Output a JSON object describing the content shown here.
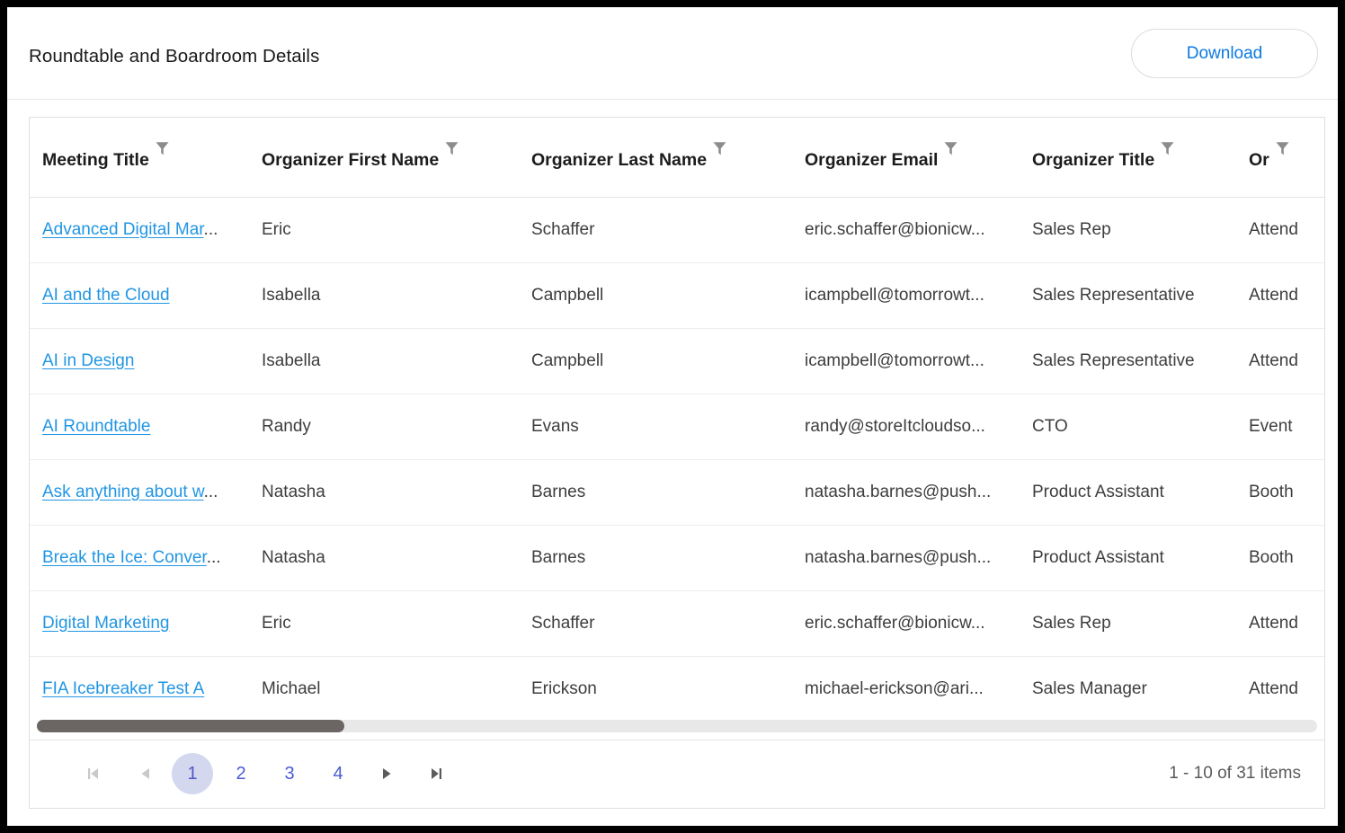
{
  "panel": {
    "title": "Roundtable and Boardroom Details",
    "download_label": "Download",
    "accent_link_color": "#2196e3",
    "download_text_color": "#0a7ae0",
    "pager_active_bg": "#d3d8ef",
    "pager_text_color": "#4a5bd4",
    "scrollbar_thumb_color": "#6b6564"
  },
  "grid": {
    "columns": [
      {
        "key": "meeting_title",
        "label": "Meeting Title",
        "filter_icon": "filter-funnel-icon"
      },
      {
        "key": "organizer_first",
        "label": "Organizer First Name",
        "filter_icon": "filter-funnel-icon"
      },
      {
        "key": "organizer_last",
        "label": "Organizer Last Name",
        "filter_icon": "filter-funnel-icon"
      },
      {
        "key": "organizer_email",
        "label": "Organizer Email",
        "filter_icon": "filter-funnel-icon"
      },
      {
        "key": "organizer_title",
        "label": "Organizer Title",
        "filter_icon": "filter-funnel-icon"
      },
      {
        "key": "organizer_role",
        "label": "Or",
        "filter_icon": "filter-funnel-icon"
      }
    ],
    "rows": [
      {
        "meeting_title": "Advanced Digital Mar",
        "meeting_title_truncated": true,
        "organizer_first": "Eric",
        "organizer_last": "Schaffer",
        "organizer_email": "eric.schaffer@bionicw...",
        "organizer_title": "Sales Rep",
        "organizer_role": "Attend"
      },
      {
        "meeting_title": "AI and the Cloud",
        "meeting_title_truncated": false,
        "organizer_first": "Isabella",
        "organizer_last": "Campbell",
        "organizer_email": "icampbell@tomorrowt...",
        "organizer_title": "Sales Representative",
        "organizer_role": "Attend"
      },
      {
        "meeting_title": "AI in Design",
        "meeting_title_truncated": false,
        "organizer_first": "Isabella",
        "organizer_last": "Campbell",
        "organizer_email": "icampbell@tomorrowt...",
        "organizer_title": "Sales Representative",
        "organizer_role": "Attend"
      },
      {
        "meeting_title": "AI Roundtable",
        "meeting_title_truncated": false,
        "organizer_first": "Randy",
        "organizer_last": "Evans",
        "organizer_email": "randy@storeItcloudso...",
        "organizer_title": "CTO",
        "organizer_role": "Event"
      },
      {
        "meeting_title": "Ask anything about w",
        "meeting_title_truncated": true,
        "organizer_first": "Natasha",
        "organizer_last": "Barnes",
        "organizer_email": "natasha.barnes@push...",
        "organizer_title": "Product Assistant",
        "organizer_role": "Booth"
      },
      {
        "meeting_title": "Break the Ice: Conver",
        "meeting_title_truncated": true,
        "organizer_first": "Natasha",
        "organizer_last": "Barnes",
        "organizer_email": "natasha.barnes@push...",
        "organizer_title": "Product Assistant",
        "organizer_role": "Booth"
      },
      {
        "meeting_title": "Digital Marketing",
        "meeting_title_truncated": false,
        "organizer_first": "Eric",
        "organizer_last": "Schaffer",
        "organizer_email": "eric.schaffer@bionicw...",
        "organizer_title": "Sales Rep",
        "organizer_role": "Attend"
      },
      {
        "meeting_title": "FIA Icebreaker Test A",
        "meeting_title_truncated": false,
        "organizer_first": "Michael",
        "organizer_last": "Erickson",
        "organizer_email": "michael-erickson@ari...",
        "organizer_title": "Sales Manager",
        "organizer_role": "Attend"
      }
    ]
  },
  "pager": {
    "first_label": "▌◀",
    "prev_label": "◀",
    "next_label": "▶",
    "last_label": "▶▌",
    "pages": [
      "1",
      "2",
      "3",
      "4"
    ],
    "active_page": "1",
    "info": "1 - 10 of 31 items"
  },
  "scrollbar": {
    "thumb_position_percent": 0,
    "thumb_width_percent": 24
  }
}
